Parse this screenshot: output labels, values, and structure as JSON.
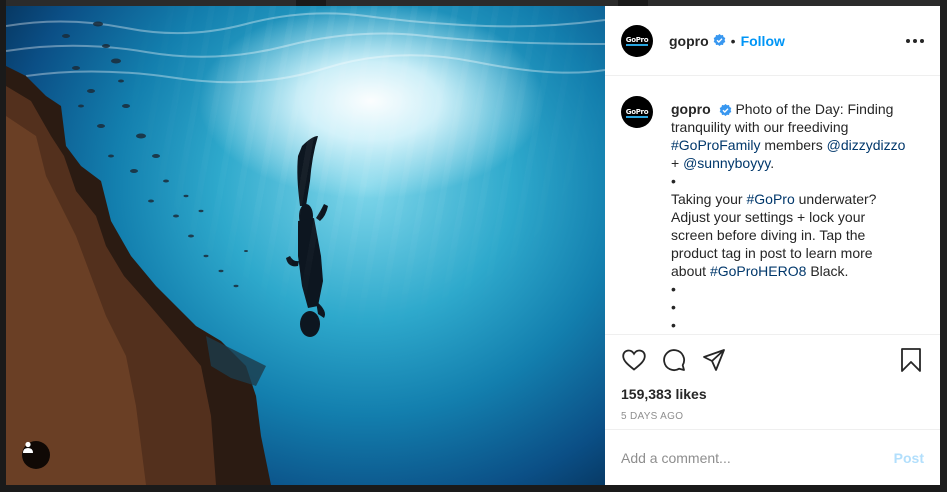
{
  "post": {
    "username": "gopro",
    "avatar_logo": "GoPro",
    "follow_label": "Follow",
    "separator": "•",
    "verified_icon": "verified-badge-icon",
    "caption": {
      "intro": "Photo of the Day: Finding tranquility with our freediving",
      "tag_family": "#GoProFamily",
      "members_text": "members",
      "mention1": "@dizzydizzo",
      "plus": "+",
      "mention2": "@sunnyboyyy",
      "period": ".",
      "bullet": "•",
      "q_before": "Taking your",
      "tag_gopro": "#GoPro",
      "q_after": "underwater? Adjust your settings + lock your screen before diving in. Tap the product tag in post to learn more about",
      "tag_hero": "#GoProHERO8",
      "black": "Black."
    },
    "likes": "159,383 likes",
    "time_ago": "5 DAYS AGO",
    "comment_placeholder": "Add a comment...",
    "post_label": "Post"
  },
  "colors": {
    "accent_blue": "#0095f6",
    "link_blue": "#00376b",
    "verified_blue": "#3897f0",
    "muted_gray": "#8e8e8e",
    "post_disabled": "#b2dffc"
  },
  "icons": [
    "heart-icon",
    "comment-icon",
    "share-icon",
    "bookmark-icon",
    "more-icon",
    "user-tag-icon"
  ]
}
